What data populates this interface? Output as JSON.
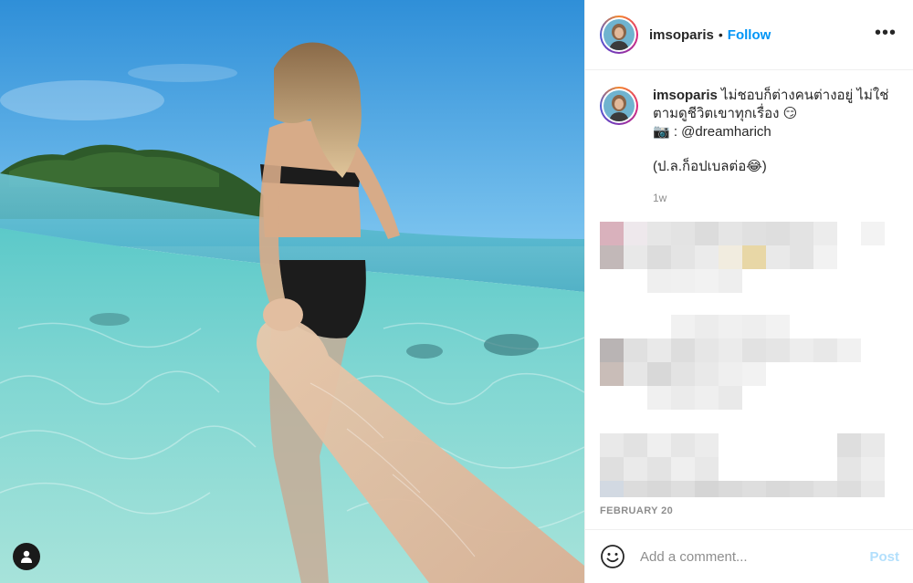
{
  "post": {
    "username": "imsoparis",
    "dot": "•",
    "follow_label": "Follow",
    "more_label": "•••",
    "caption_user": "imsoparis",
    "caption_line1": "ไม่ชอบก็ต่างคนต่างอยู่ ไม่ใช่",
    "caption_line2": "ตามดูชีวิตเขาทุกเรื่อง 😏",
    "caption_line3": "📷 : @dreamharich",
    "caption_line4": "(ป.ล.ก็อปเบลต่อ😂)",
    "time_ago": "1w",
    "date": "FEBRUARY 20"
  },
  "comment": {
    "placeholder": "Add a comment...",
    "post_label": "Post"
  },
  "colors": {
    "follow": "#0095f6",
    "post_disabled": "#b2dffc",
    "muted": "#8e8e8e"
  },
  "icons": [
    "user-tag-icon",
    "more-options-icon",
    "emoji-icon"
  ]
}
